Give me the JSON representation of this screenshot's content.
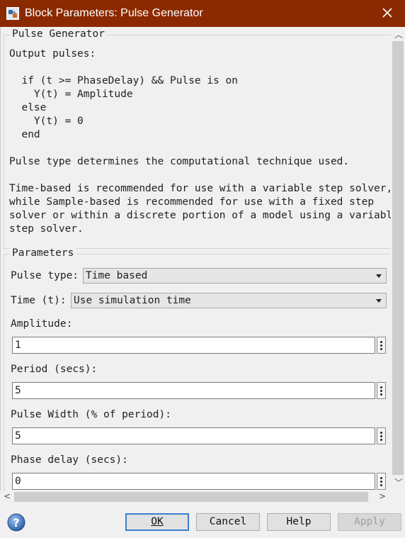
{
  "window": {
    "title": "Block Parameters: Pulse Generator"
  },
  "block": {
    "group_title": "Pulse Generator",
    "desc_intro": "Output pulses:",
    "desc_code": "  if (t >= PhaseDelay) && Pulse is on\n    Y(t) = Amplitude\n  else\n    Y(t) = 0\n  end",
    "desc_pulse_type": "Pulse type determines the computational technique used.",
    "desc_recommend": "Time-based is recommended for use with a variable step solver,\nwhile Sample-based is recommended for use with a fixed step\nsolver or within a discrete portion of a model using a variable\nstep solver."
  },
  "parameters": {
    "group_title": "Parameters",
    "pulse_type_label": "Pulse type:",
    "pulse_type_value": "Time based",
    "time_label": "Time (t):",
    "time_value": "Use simulation time",
    "amplitude_label": "Amplitude:",
    "amplitude_value": "1",
    "period_label": "Period (secs):",
    "period_value": "5",
    "pulse_width_label": "Pulse Width (% of period):",
    "pulse_width_value": "5",
    "phase_delay_label": "Phase delay (secs):",
    "phase_delay_value": "0"
  },
  "buttons": {
    "ok": "OK",
    "cancel": "Cancel",
    "help": "Help",
    "apply": "Apply"
  },
  "icons": {
    "app": "simulink-block-icon",
    "close": "close-icon",
    "help": "question-icon",
    "field_menu": "vertical-ellipsis-icon"
  },
  "colors": {
    "titlebar": "#8b2a00",
    "default_button_border": "#3c7fd1"
  }
}
